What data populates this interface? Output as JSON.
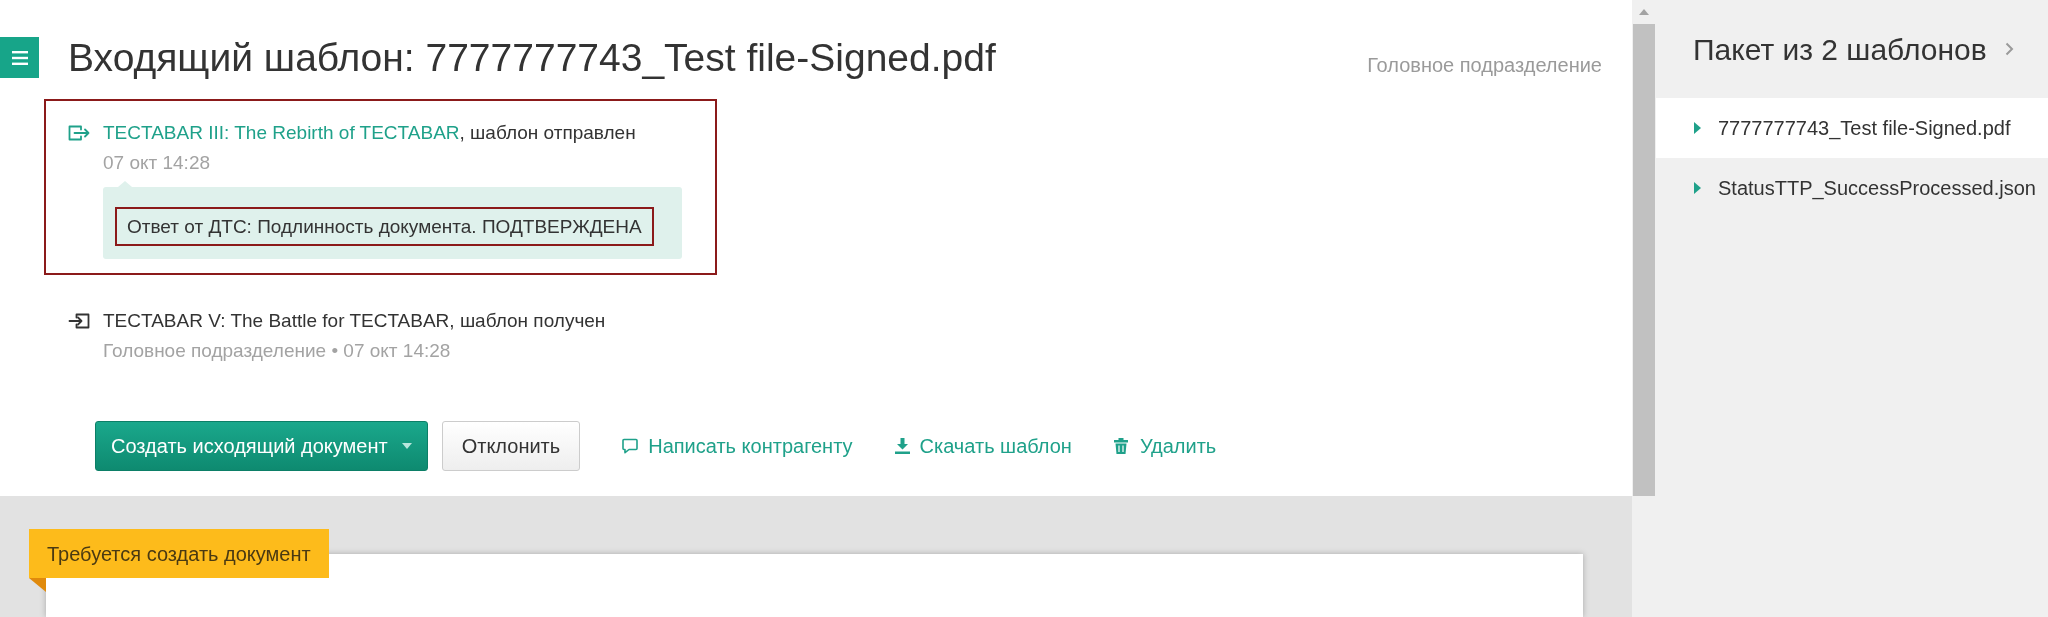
{
  "header": {
    "title": "Входящий шаблон: 7777777743_Test file-Signed.pdf",
    "department": "Головное подразделение"
  },
  "events": [
    {
      "kind": "sent",
      "highlighted": true,
      "link": "TECTABAR III: The Rebirth of TECTABAR",
      "text": ", шаблон отправлен",
      "meta": "07 окт 14:28",
      "reply": {
        "text": "Ответ от ДТС: Подлинность документа. ПОДТВЕРЖДЕНА",
        "highlighted": true
      }
    },
    {
      "kind": "received",
      "highlighted": false,
      "text": "TECTABAR V: The Battle for TECTABAR, шаблон получен",
      "meta": "Головное подразделение • 07 окт 14:28"
    }
  ],
  "actions": [
    {
      "kind": "primary",
      "label": "Создать исходящий документ",
      "dropdown": true
    },
    {
      "kind": "secondary",
      "label": "Отклонить"
    },
    {
      "kind": "message",
      "label": "Написать контрагенту"
    },
    {
      "kind": "download",
      "label": "Скачать шаблон"
    },
    {
      "kind": "delete",
      "label": "Удалить"
    }
  ],
  "banner": {
    "text": "Требуется создать документ"
  },
  "package": {
    "title": "Пакет из 2 шаблонов",
    "files": [
      {
        "name": "7777777743_Test file-Signed.pdf",
        "selected": true
      },
      {
        "name": "StatusTTP_SuccessProcessed.json",
        "selected": false
      }
    ]
  }
}
